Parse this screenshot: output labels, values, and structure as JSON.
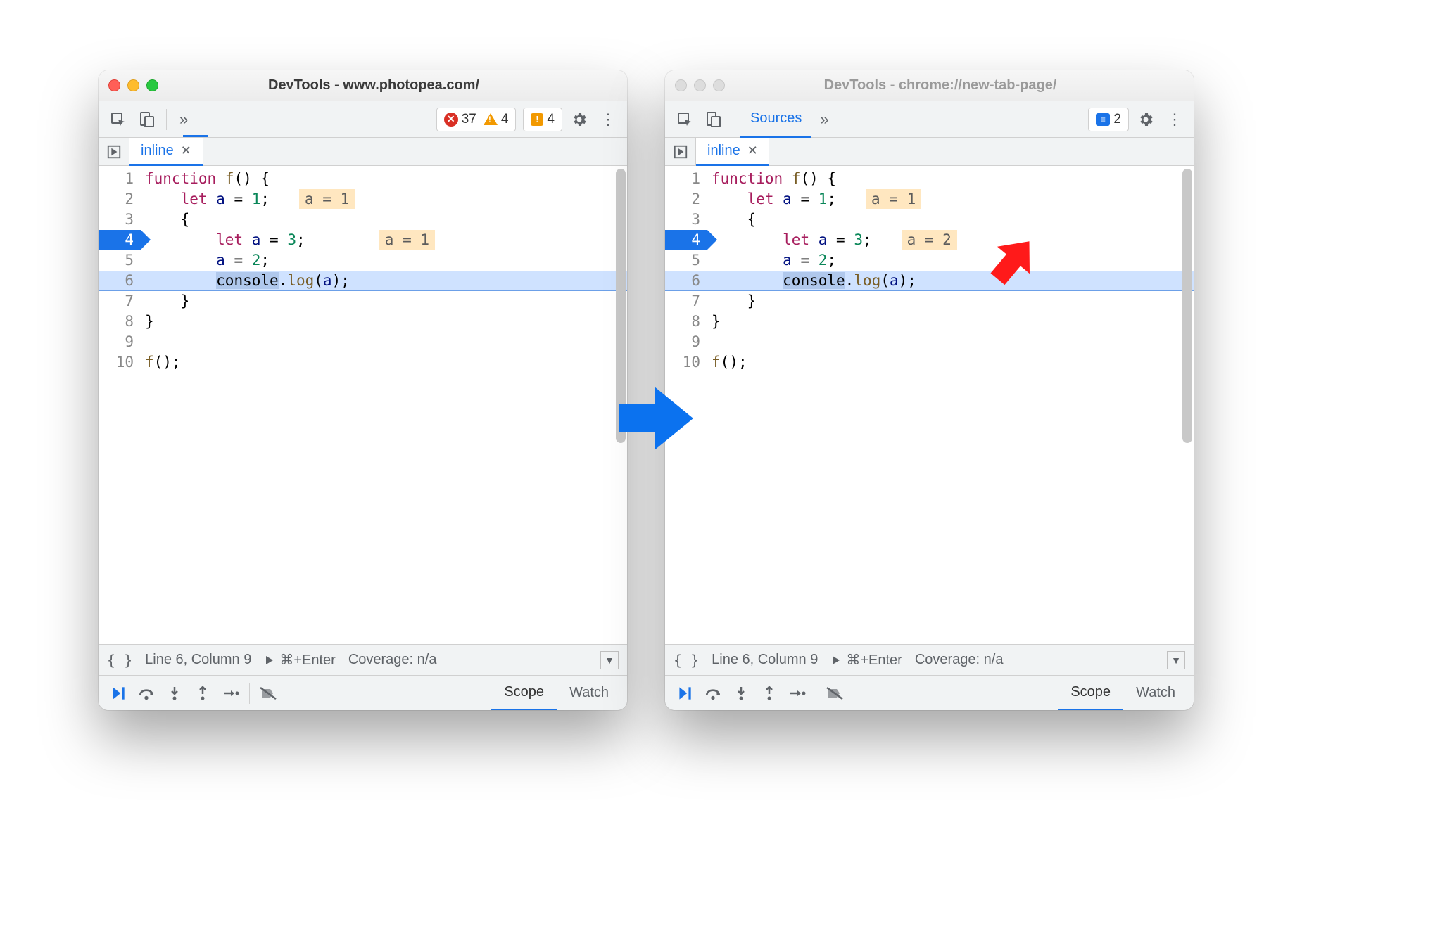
{
  "left": {
    "title": "DevTools - www.photopea.com/",
    "active": true,
    "toolbar": {
      "errors": "37",
      "warnings": "4",
      "issues": "4",
      "show_tab": false,
      "tab_label": "",
      "messages": ""
    },
    "tab_name": "inline",
    "status": {
      "pos": "Line 6, Column 9",
      "run": "⌘+Enter",
      "coverage": "Coverage: n/a"
    },
    "debug_tabs": {
      "scope": "Scope",
      "watch": "Watch"
    },
    "exec_line": 4,
    "highlight_line": 6,
    "inline_vals": {
      "l2": "a = 1",
      "l4": "a = 1"
    }
  },
  "right": {
    "title": "DevTools - chrome://new-tab-page/",
    "active": false,
    "toolbar": {
      "errors": "",
      "warnings": "",
      "issues": "",
      "show_tab": true,
      "tab_label": "Sources",
      "messages": "2"
    },
    "tab_name": "inline",
    "status": {
      "pos": "Line 6, Column 9",
      "run": "⌘+Enter",
      "coverage": "Coverage: n/a"
    },
    "debug_tabs": {
      "scope": "Scope",
      "watch": "Watch"
    },
    "exec_line": 4,
    "highlight_line": 6,
    "inline_vals": {
      "l2": "a = 1",
      "l4": "a = 2"
    }
  },
  "code": {
    "lines": [
      "function f() {",
      "    let a = 1;",
      "    {",
      "        let a = 3;",
      "        a = 2;",
      "        console.log(a);",
      "    }",
      "}",
      "",
      "f();"
    ]
  }
}
